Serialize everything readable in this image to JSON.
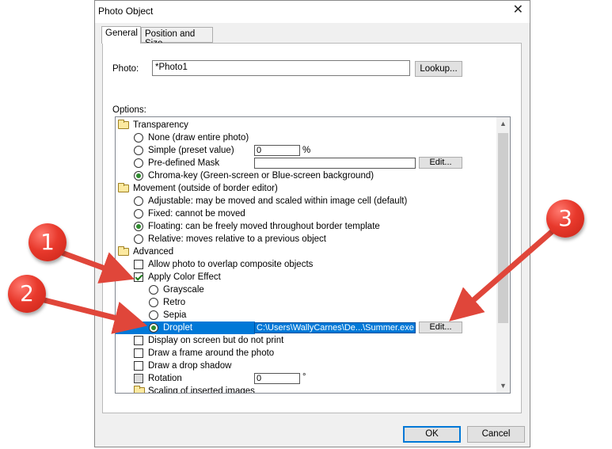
{
  "window": {
    "title": "Photo Object",
    "close_glyph": "✕"
  },
  "tabs": [
    {
      "label": "General",
      "active": true
    },
    {
      "label": "Position and Size",
      "active": false
    }
  ],
  "photo": {
    "label": "Photo:",
    "value": "*Photo1",
    "lookup_label": "Lookup..."
  },
  "options": {
    "label": "Options:",
    "transparency": {
      "heading": "Transparency",
      "none": "None  (draw entire photo)",
      "simple": "Simple (preset value)",
      "simple_value": "0",
      "simple_unit": "%",
      "mask": "Pre-defined Mask",
      "mask_value": "",
      "mask_edit": "Edit...",
      "chroma": "Chroma-key (Green-screen or Blue-screen background)",
      "selected": "chroma"
    },
    "movement": {
      "heading": "Movement  (outside of border editor)",
      "adjustable": "Adjustable:  may be moved and scaled within image cell (default)",
      "fixed": "Fixed:  cannot be moved",
      "floating": "Floating:  can be freely moved throughout border template",
      "relative": "Relative:  moves relative to a previous object",
      "selected": "floating"
    },
    "advanced": {
      "heading": "Advanced",
      "overlap": "Allow photo to overlap composite objects",
      "overlap_checked": false,
      "color_effect": "Apply Color Effect",
      "color_effect_checked": true,
      "grayscale": "Grayscale",
      "retro": "Retro",
      "sepia": "Sepia",
      "droplet": "Droplet",
      "droplet_value": "C:\\Users\\WallyCarnes\\De...\\Summer.exe",
      "droplet_edit": "Edit...",
      "effect_selected": "droplet",
      "display_no_print": "Display on screen but do not print",
      "frame": "Draw a frame around the photo",
      "shadow": "Draw a drop shadow",
      "rotation": "Rotation",
      "rotation_value": "0",
      "rotation_unit": "°",
      "scaling": "Scaling of inserted images"
    }
  },
  "buttons": {
    "ok": "OK",
    "cancel": "Cancel"
  },
  "callouts": [
    "1",
    "2",
    "3"
  ],
  "colors": {
    "selection": "#0078d7",
    "callout": "#e8392c",
    "arrow": "#e0463a"
  }
}
